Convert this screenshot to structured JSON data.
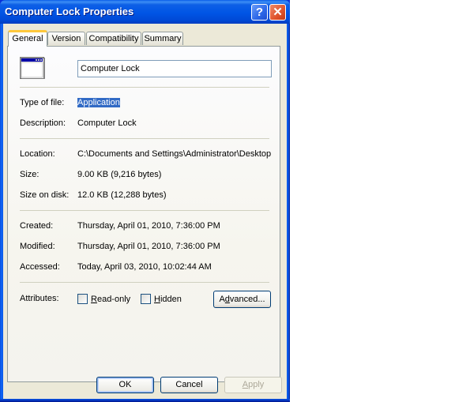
{
  "window": {
    "title": "Computer Lock Properties",
    "help_glyph": "?",
    "close_glyph": "✕"
  },
  "tabs": [
    {
      "label": "General",
      "active": true
    },
    {
      "label": "Version",
      "active": false
    },
    {
      "label": "Compatibility",
      "active": false
    },
    {
      "label": "Summary",
      "active": false
    }
  ],
  "general": {
    "icon": "application-window-icon",
    "name_value": "Computer Lock",
    "fields": {
      "type": {
        "label": "Type of file:",
        "value": "Application"
      },
      "description": {
        "label": "Description:",
        "value": "Computer Lock"
      },
      "location": {
        "label": "Location:",
        "value": "C:\\Documents and Settings\\Administrator\\Desktop"
      },
      "size": {
        "label": "Size:",
        "value": "9.00 KB (9,216 bytes)"
      },
      "size_on_disk": {
        "label": "Size on disk:",
        "value": "12.0 KB (12,288 bytes)"
      },
      "created": {
        "label": "Created:",
        "value": "Thursday, April 01, 2010, 7:36:00 PM"
      },
      "modified": {
        "label": "Modified:",
        "value": "Thursday, April 01, 2010, 7:36:00 PM"
      },
      "accessed": {
        "label": "Accessed:",
        "value": "Today, April 03, 2010, 10:02:44 AM"
      }
    },
    "attributes": {
      "label": "Attributes:",
      "readonly": {
        "access_key": "R",
        "rest": "ead-only",
        "checked": false
      },
      "hidden": {
        "access_key": "H",
        "rest": "idden",
        "checked": false
      },
      "advanced": {
        "pre": "A",
        "access_key": "d",
        "rest": "vanced..."
      }
    }
  },
  "buttons": {
    "ok": "OK",
    "cancel": "Cancel",
    "apply_key": "A",
    "apply_rest": "pply"
  },
  "colors": {
    "title_bar": "#0055e5",
    "selection": "#316ac5",
    "tab_highlight": "#ffc83c"
  }
}
